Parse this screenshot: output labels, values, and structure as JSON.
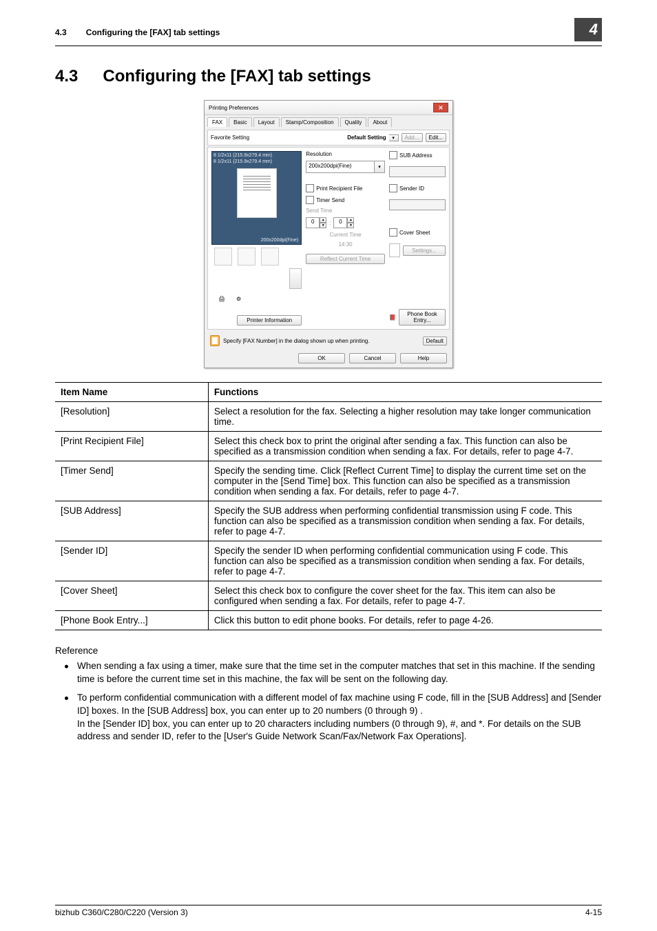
{
  "header": {
    "section_num": "4.3",
    "section_title_header": "Configuring the [FAX] tab settings",
    "chapter_number": "4"
  },
  "heading": {
    "num": "4.3",
    "title": "Configuring the [FAX] tab settings"
  },
  "dialog": {
    "title": "Printing Preferences",
    "tabs": [
      "FAX",
      "Basic",
      "Layout",
      "Stamp/Composition",
      "Quality",
      "About"
    ],
    "favorite_label": "Favorite Setting",
    "default_setting": "Default Setting",
    "add_btn": "Add...",
    "edit_btn": "Edit...",
    "paper_size_line1": "8 1/2x11 (215.9x279.4 mm)",
    "paper_size_line2": "8 1/2x11 (215.9x279.4 mm)",
    "preview_mode": "200x200dpi(Fine)",
    "resolution_label": "Resolution",
    "resolution_value": "200x200dpi(Fine)",
    "print_recipient": "Print Recipient File",
    "timer_send": "Timer Send",
    "send_time": "Send Time",
    "spin_hh": "0",
    "spin_mm": "0",
    "current_time_label": "Current Time",
    "current_time_value": "14:30",
    "reflect_btn": "Reflect Current Time",
    "sub_address": "SUB Address",
    "sender_id": "Sender ID",
    "cover_sheet": "Cover Sheet",
    "settings_btn": "Settings...",
    "phone_book_btn": "Phone Book Entry...",
    "printer_info_btn": "Printer Information",
    "note_text": "Specify [FAX Number] in the dialog shown up when printing.",
    "default_btn": "Default",
    "ok_btn": "OK",
    "cancel_btn": "Cancel",
    "help_btn": "Help"
  },
  "table": {
    "header": {
      "col1": "Item Name",
      "col2": "Functions"
    },
    "rows": [
      {
        "name": "[Resolution]",
        "func": "Select a resolution for the fax. Selecting a higher resolution may take longer communication time."
      },
      {
        "name": "[Print Recipient File]",
        "func": "Select this check box to print the original after sending a fax. This function can also be specified as a transmission condition when sending a fax. For details, refer to page 4-7."
      },
      {
        "name": "[Timer Send]",
        "func": "Specify the sending time. Click [Reflect Current Time] to display the current time set on the computer in the [Send Time] box. This function can also be specified as a transmission condition when sending a fax. For details, refer to page 4-7."
      },
      {
        "name": "[SUB Address]",
        "func": "Specify the SUB address when performing confidential transmission using F code. This function can also be specified as a transmission condition when sending a fax. For details, refer to page 4-7."
      },
      {
        "name": "[Sender ID]",
        "func": "Specify the sender ID when performing confidential communication using F code. This function can also be specified as a transmission condition when sending a fax. For details, refer to page 4-7."
      },
      {
        "name": "[Cover Sheet]",
        "func": "Select this check box to configure the cover sheet for the fax. This item can also be configured when sending a fax. For details, refer to page 4-7."
      },
      {
        "name": "[Phone Book Entry...]",
        "func": "Click this button to edit phone books. For details, refer to page 4-26."
      }
    ]
  },
  "reference": {
    "title": "Reference",
    "items": [
      "When sending a fax using a timer, make sure that the time set in the computer matches that set in this machine. If the sending time is before the current time set in this machine, the fax will be sent on the following day.",
      "To perform confidential communication with a different model of fax machine using F code, fill in the [SUB Address] and [Sender ID] boxes. In the [SUB Address] box, you can enter up to 20 numbers (0 through 9) .\nIn the [Sender ID] box, you can enter up to 20 characters including numbers (0 through 9), #, and *. For details on the SUB address and sender ID, refer to the [User's Guide Network Scan/Fax/Network Fax Operations]."
    ]
  },
  "footer": {
    "left": "bizhub C360/C280/C220 (Version 3)",
    "right": "4-15"
  }
}
